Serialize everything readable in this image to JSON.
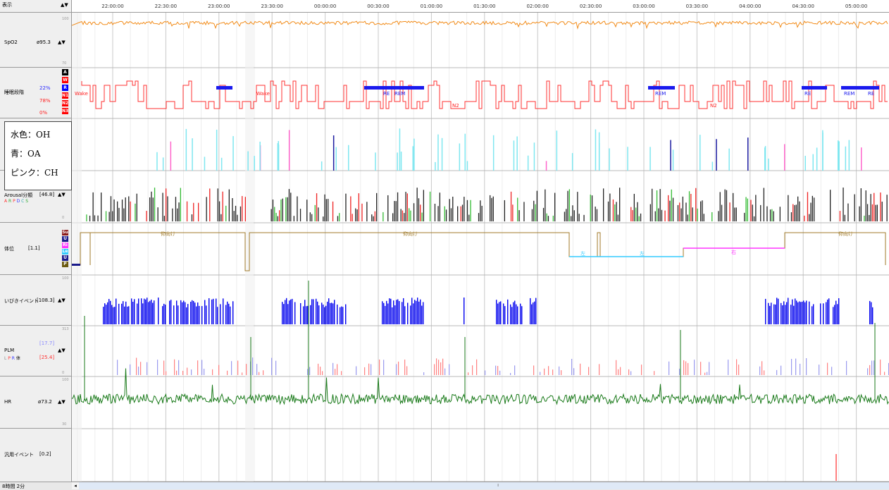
{
  "header": {
    "menu_label": "表示",
    "menu_arrows": "▲▼"
  },
  "time_axis": {
    "ticks": [
      "22:00:00",
      "22:30:00",
      "23:00:00",
      "23:30:00",
      "00:00:00",
      "00:30:00",
      "01:00:00",
      "01:30:00",
      "02:00:00",
      "02:30:00",
      "03:00:00",
      "03:30:00",
      "04:00:00",
      "04:30:00",
      "05:00:00"
    ]
  },
  "channels": {
    "spo2": {
      "name": "SpO2",
      "value": "ø95.3",
      "arrows": "▲▼",
      "scale_top": "100",
      "scale_bottom": "70",
      "color": "#f28c1a"
    },
    "sleep_stage": {
      "name": "睡眠段階",
      "pct_top": "22%",
      "pct_mid": "78%",
      "pct_bottom": "0%",
      "stage_labels": [
        "A",
        "W",
        "R",
        "N1",
        "N2",
        "N3"
      ],
      "stage_colors": [
        "#000000",
        "#ff0000",
        "#0000ff",
        "#ff0000",
        "#ff0000",
        "#ff0000"
      ],
      "annotations": [
        "Wake",
        "Wake",
        "RE",
        "REM",
        "N2",
        "REM",
        "N2",
        "RE",
        "REM",
        "RE"
      ],
      "color": "#ff3030"
    },
    "respiratory": {
      "colors": {
        "oh": "#7fe7f0",
        "oa": "#1a1aa0",
        "ch": "#ff66cc"
      }
    },
    "arousal": {
      "name": "Arousal分類",
      "value": "[46.8]",
      "arrows": "▲▼",
      "sub_labels": [
        "A",
        "R",
        "P",
        "D",
        "C",
        "S"
      ],
      "sub_colors": [
        "#ff3333",
        "#33aa33",
        "#ff3333",
        "#3333ff",
        "#33aaaa",
        "#33aa33"
      ],
      "scale_bottom": "0"
    },
    "position": {
      "name": "体位",
      "value": "[1.1]",
      "stage_labels": [
        "Su",
        "U",
        "Ri",
        "Le",
        "U",
        "P"
      ],
      "stage_colors": [
        "#8b1a1a",
        "#1a1a8b",
        "#ff33ff",
        "#33ccff",
        "#1a1a8b",
        "#6b5a10"
      ],
      "annotations": [
        "仰向け",
        "仰向け",
        "左",
        "左",
        "右",
        "仰向け"
      ]
    },
    "snore": {
      "name": "いびきイベント",
      "value": "[108.3]",
      "arrows": "▲▼",
      "scale_top": "100",
      "color": "#0000ee"
    },
    "plm": {
      "name": "PLM",
      "value_top": "[17.7]",
      "value_bottom": "[25.4]",
      "arrows": "▲▼",
      "sub_labels": [
        "L",
        "P",
        "R",
        "体"
      ],
      "scale_top": "313",
      "scale_bottom": "0"
    },
    "hr": {
      "name": "HR",
      "value": "ø73.2",
      "arrows": "▲▼",
      "scale_top": "100",
      "scale_bottom": "30",
      "color": "#1a7a1a"
    },
    "generic_event": {
      "name": "汎用イベント",
      "value": "[0.2]"
    }
  },
  "legend": {
    "items": [
      "水色：OH",
      "青：OA",
      "ピンク：CH"
    ]
  },
  "footer": {
    "duration": "8時間 2分",
    "scroll_left": "◂",
    "scroll_thumb": "⦀"
  }
}
